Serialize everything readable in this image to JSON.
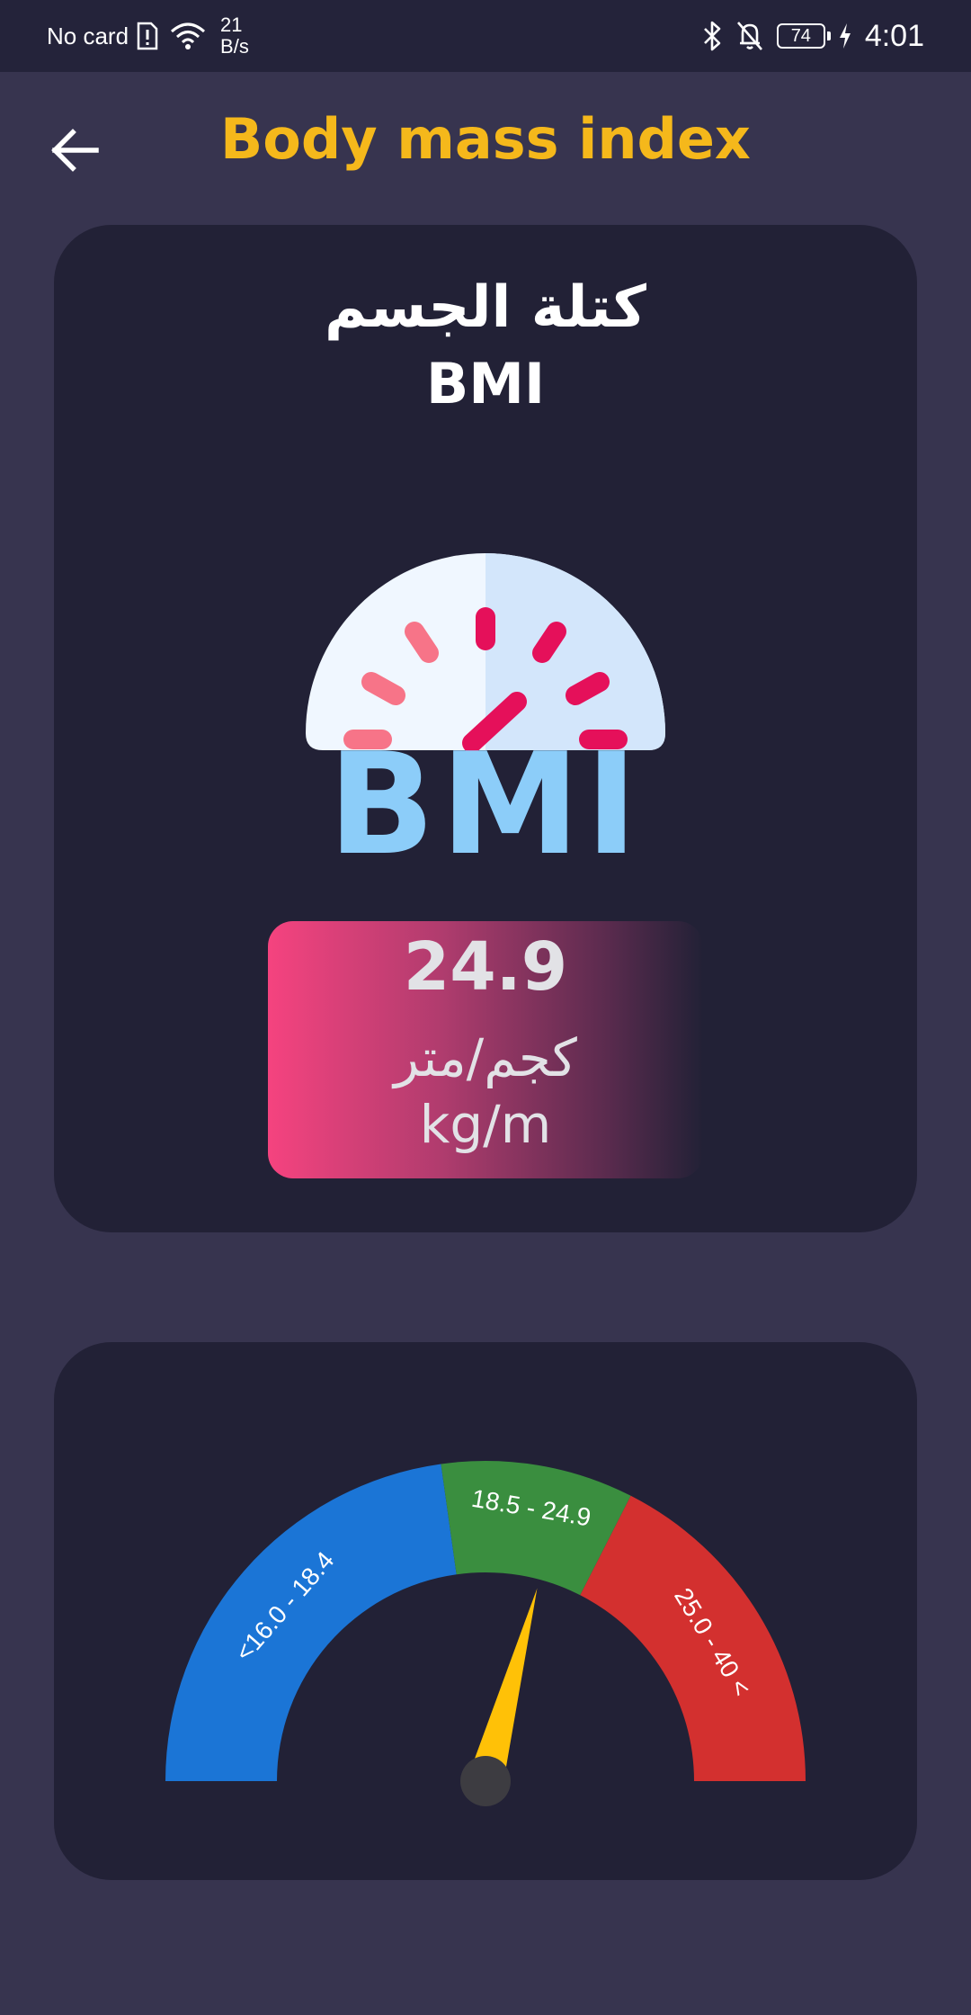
{
  "status_bar": {
    "carrier": "No card",
    "net_speed_value": "21",
    "net_speed_unit": "B/s",
    "battery_level": "74",
    "time": "4:01"
  },
  "header": {
    "title": "Body mass index"
  },
  "bmi_card": {
    "title_ar": "كتلة الجسم",
    "title_en": "BMI",
    "icon_text": "BMI",
    "value": "24.9",
    "unit_ar": "كجم/متر",
    "unit_en": "kg/m"
  },
  "gauge": {
    "value": 24.9,
    "ranges": [
      {
        "label": "<16.0 - 18.4",
        "color": "#1b75d6"
      },
      {
        "label": "18.5 - 24.9",
        "color": "#3a8e3f"
      },
      {
        "label": "25.0 - 40 <",
        "color": "#d3302f"
      }
    ],
    "needle_color": "#ffc107"
  }
}
